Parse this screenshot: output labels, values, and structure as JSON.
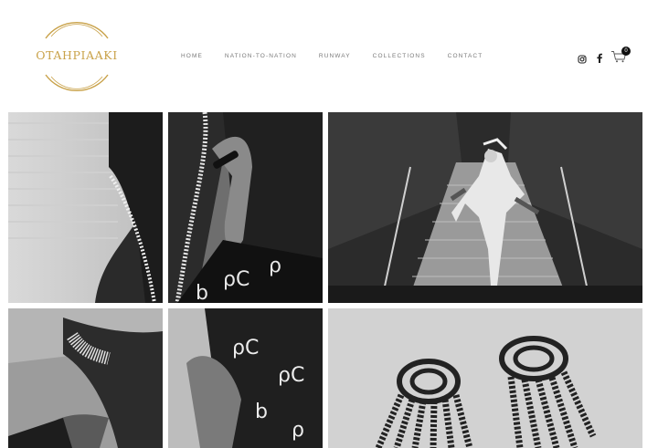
{
  "brand": {
    "logo_text": "OTAHPIAAKI",
    "accent_color": "#c9a24a"
  },
  "nav": {
    "items": [
      {
        "label": "HOME"
      },
      {
        "label": "NATION-TO-NATION"
      },
      {
        "label": "RUNWAY"
      },
      {
        "label": "COLLECTIONS"
      },
      {
        "label": "CONTACT"
      }
    ]
  },
  "header_icons": {
    "instagram": "instagram-icon",
    "facebook": "facebook-icon",
    "cart": "cart-icon",
    "cart_count": "0"
  },
  "gallery": {
    "images": [
      {
        "name": "fringe-bag-tile"
      },
      {
        "name": "bag-hand-tile"
      },
      {
        "name": "dancer-escalator-tile"
      },
      {
        "name": "fringe-lower-tile"
      },
      {
        "name": "bag-lower-tile"
      },
      {
        "name": "beaded-earrings-tile"
      }
    ]
  }
}
